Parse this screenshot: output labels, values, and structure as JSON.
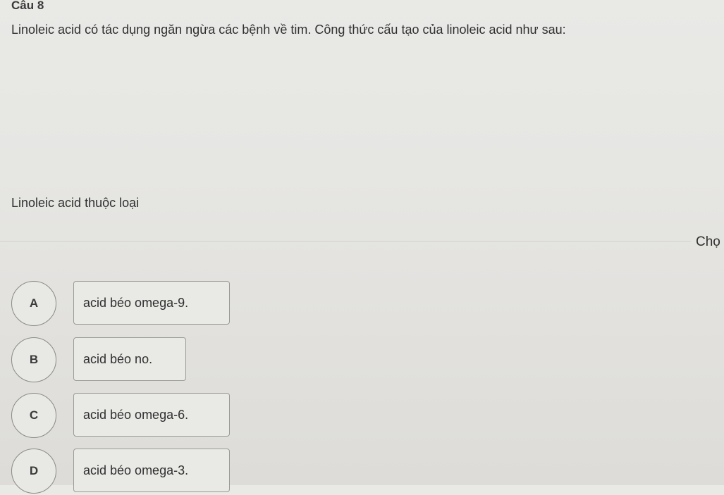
{
  "question": {
    "number": "Câu 8",
    "text": "Linoleic acid có tác dụng ngăn ngừa các bệnh về tim. Công thức cấu tạo của linoleic acid như sau:",
    "sub_question": "Linoleic acid thuộc loại"
  },
  "choose_label": "Chọ",
  "options": [
    {
      "letter": "A",
      "text": "acid béo omega-9."
    },
    {
      "letter": "B",
      "text": "acid béo no."
    },
    {
      "letter": "C",
      "text": "acid béo omega-6."
    },
    {
      "letter": "D",
      "text": "acid béo omega-3."
    }
  ]
}
